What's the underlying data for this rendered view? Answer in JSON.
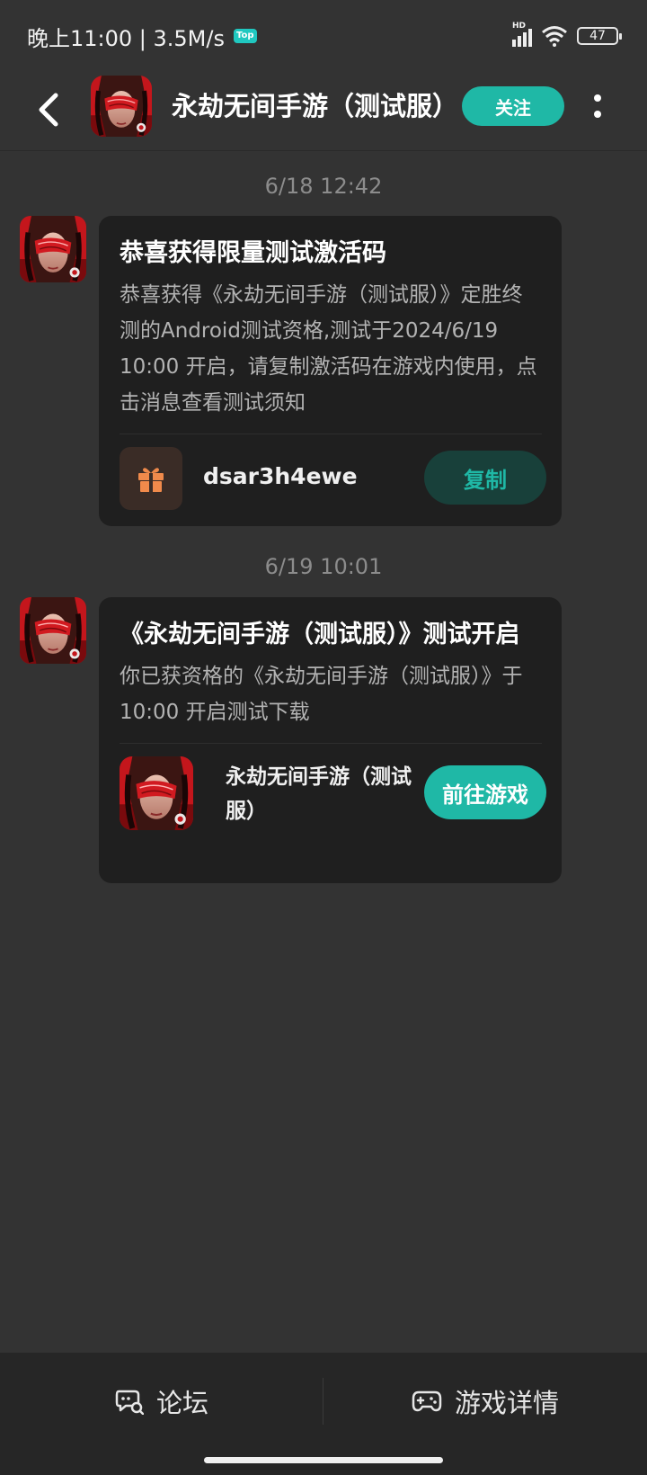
{
  "status_bar": {
    "time_speed": "晚上11:00 | 3.5M/s",
    "top_badge": "Top",
    "network_label": "HD",
    "battery": "47"
  },
  "header": {
    "title": "永劫无间手游（测试服）",
    "follow_label": "关注"
  },
  "messages": [
    {
      "timestamp": "6/18   12:42",
      "title": "恭喜获得限量测试激活码",
      "body": "恭喜获得《永劫无间手游（测试服）》定胜终测的Android测试资格,测试于2024/6/19 10:00 开启，请复制激活码在游戏内使用，点击消息查看测试须知",
      "code": "dsar3h4ewe",
      "copy_label": "复制"
    },
    {
      "timestamp": "6/19   10:01",
      "title": "《永劫无间手游（测试服）》测试开启",
      "body": "你已获资格的《永劫无间手游（测试服）》于 10:00 开启测试下载",
      "game_name": "永劫无间手游（测试服）",
      "goto_label": "前往游戏"
    }
  ],
  "bottom_bar": {
    "forum_label": "论坛",
    "details_label": "游戏详情"
  },
  "colors": {
    "accent": "#1fb8a6",
    "background": "#333333",
    "card": "#1f1f1f",
    "gift_icon": "#f08a4b"
  },
  "icons": [
    "back-arrow-icon",
    "more-dots-icon",
    "gift-icon",
    "chat-icon",
    "gamepad-icon",
    "wifi-icon",
    "signal-icon",
    "battery-icon"
  ]
}
